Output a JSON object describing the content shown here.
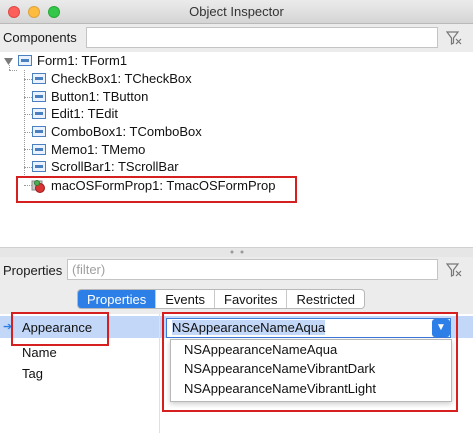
{
  "window": {
    "title": "Object Inspector"
  },
  "components": {
    "label": "Components",
    "search_value": ""
  },
  "tree": {
    "root": "Form1: TForm1",
    "children": [
      "CheckBox1: TCheckBox",
      "Button1: TButton",
      "Edit1: TEdit",
      "ComboBox1: TComboBox",
      "Memo1: TMemo",
      "ScrollBar1: TScrollBar",
      "macOSFormProp1: TmacOSFormProp"
    ]
  },
  "properties": {
    "label": "Properties",
    "filter_placeholder": "(filter)",
    "tabs": [
      "Properties",
      "Events",
      "Favorites",
      "Restricted"
    ],
    "active_tab": "Properties",
    "rows": [
      "Appearance",
      "Name",
      "Tag"
    ],
    "appearance_value": "NSAppearanceNameAqua",
    "options": [
      "NSAppearanceNameAqua",
      "NSAppearanceNameVibrantDark",
      "NSAppearanceNameVibrantLight"
    ]
  },
  "colors": {
    "accent": "#2d7fe8",
    "highlight_box": "#d62020",
    "selected_row": "#c3d8f8"
  }
}
